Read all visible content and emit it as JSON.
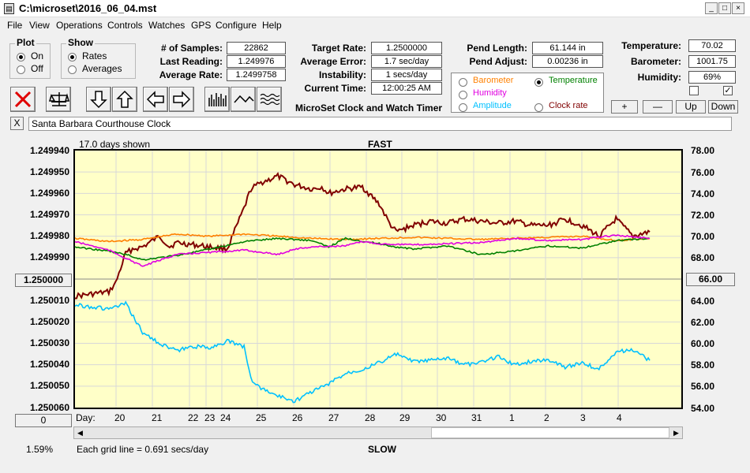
{
  "window": {
    "title": "C:\\microset\\2016_06_04.mst",
    "minimize": "_",
    "maximize": "□",
    "close": "×"
  },
  "menu": [
    "File",
    "View",
    "Operations",
    "Controls",
    "Watches",
    "GPS",
    "Configure",
    "Help"
  ],
  "plot_group": {
    "title": "Plot",
    "options": [
      {
        "label": "On",
        "selected": true
      },
      {
        "label": "Off",
        "selected": false
      }
    ]
  },
  "show_group": {
    "title": "Show",
    "options": [
      {
        "label": "Rates",
        "selected": true
      },
      {
        "label": "Averages",
        "selected": false
      }
    ]
  },
  "stats": {
    "samples_label": "# of Samples:",
    "samples": "22862",
    "last_label": "Last Reading:",
    "last": "1.249976",
    "avg_label": "Average Rate:",
    "avg": "1.2499758",
    "target_label": "Target Rate:",
    "target": "1.2500000",
    "avgerr_label": "Average Error:",
    "avgerr": "1.7 sec/day",
    "instab_label": "Instability:",
    "instab": "1 secs/day",
    "time_label": "Current Time:",
    "time": "12:00:25 AM",
    "app_name": "MicroSet Clock and Watch Timer",
    "pendlen_label": "Pend Length:",
    "pendlen": "61.144 in",
    "pendadj_label": "Pend Adjust:",
    "pendadj": "0.00236 in",
    "temp_label": "Temperature:",
    "temp": "70.02",
    "baro_label": "Barometer:",
    "baro": "1001.75",
    "hum_label": "Humidity:",
    "hum": "69%"
  },
  "sensor_select": {
    "options": [
      {
        "label": "Barometer",
        "color": "#ff8000",
        "selected": false
      },
      {
        "label": "Temperature",
        "color": "#008000",
        "selected": true
      },
      {
        "label": "Humidity",
        "color": "#e000e0",
        "selected": false
      },
      {
        "label": "Amplitude",
        "color": "#00c0ff",
        "selected": false
      },
      {
        "label": "Clock rate",
        "color": "#800000",
        "selected": false
      }
    ]
  },
  "scale_buttons": [
    "+",
    "—",
    "Up",
    "Down"
  ],
  "checkboxes": [
    {
      "checked": false
    },
    {
      "checked": true
    }
  ],
  "toolbar": [
    "close-x",
    "balance-scale",
    "arrow-down",
    "arrow-up",
    "arrow-left",
    "arrow-right",
    "bars",
    "wave",
    "multi-wave"
  ],
  "clock_name": "Santa Barbara Courthouse Clock",
  "clear_label": "X",
  "chart_data": {
    "type": "line",
    "header_left": "17.0 days shown",
    "title_top": "FAST",
    "title_bottom": "SLOW",
    "footer_left": "1.59%",
    "footer_grid": "Each grid line = 0.691 secs/day",
    "left_axis": {
      "ticks": [
        "1.249940",
        "1.249950",
        "1.249960",
        "1.249970",
        "1.249980",
        "1.249990",
        "1.250000",
        "1.250010",
        "1.250020",
        "1.250030",
        "1.250040",
        "1.250050",
        "1.250060"
      ],
      "range": [
        1.24994,
        1.25006
      ],
      "center_button": "1.250000",
      "bottom_button": "0"
    },
    "right_axis": {
      "ticks": [
        "78.00",
        "76.00",
        "74.00",
        "72.00",
        "70.00",
        "68.00",
        "66.00",
        "64.00",
        "62.00",
        "60.00",
        "58.00",
        "56.00",
        "54.00"
      ],
      "range": [
        54,
        78
      ],
      "center_button": "66.00"
    },
    "x_label": "Day:",
    "days": [
      "20",
      "21",
      "22",
      "23",
      "24",
      "25",
      "26",
      "27",
      "28",
      "29",
      "30",
      "31",
      "1",
      "2",
      "3",
      "4"
    ],
    "series": [
      {
        "name": "Clock rate",
        "color": "#800000",
        "x": [
          0,
          1,
          1.2,
          1.35,
          1.5,
          1.7,
          2,
          2.3,
          2.5,
          2.8,
          3,
          3.5,
          4,
          4.5,
          5,
          5.2,
          5.5,
          6,
          6.5,
          7,
          7.3,
          7.5,
          8,
          8.5,
          9,
          9.3,
          9.5,
          10,
          10.5,
          11,
          11.5,
          12,
          12.5,
          13,
          13.5,
          14,
          14.5,
          15,
          15.5,
          16,
          16.5,
          17
        ],
        "y": [
          1.250008,
          1.250006,
          1.250002,
          1.249995,
          1.249988,
          1.249986,
          1.249985,
          1.249982,
          1.24998,
          1.249985,
          1.249983,
          1.249984,
          1.249985,
          1.249986,
          1.249967,
          1.249958,
          1.249955,
          1.249952,
          1.249956,
          1.249958,
          1.249957,
          1.24996,
          1.249958,
          1.249957,
          1.249965,
          1.249974,
          1.249978,
          1.249975,
          1.249973,
          1.249974,
          1.249972,
          1.249973,
          1.249974,
          1.249973,
          1.249975,
          1.249975,
          1.249972,
          1.249975,
          1.24998,
          1.249972,
          1.24998,
          1.249978
        ]
      },
      {
        "name": "Barometer",
        "color": "#ff8000",
        "x": [
          0,
          1,
          2,
          3,
          4,
          5,
          6,
          7,
          8,
          9,
          10,
          11,
          12,
          13,
          14,
          15,
          16,
          17
        ],
        "y": [
          69.8,
          69.5,
          69.7,
          70.2,
          70.0,
          70.2,
          70.0,
          69.8,
          69.7,
          69.8,
          69.9,
          69.8,
          69.7,
          69.8,
          69.9,
          70.0,
          69.6,
          69.8
        ]
      },
      {
        "name": "Temperature",
        "color": "#008000",
        "x": [
          0,
          1,
          1.5,
          2,
          3,
          3.5,
          4,
          5,
          6,
          7,
          7.5,
          8,
          9,
          9.5,
          10,
          11,
          12,
          13,
          14,
          15,
          16,
          17
        ],
        "y": [
          69.0,
          68.6,
          68.3,
          67.8,
          68.2,
          68.5,
          68.8,
          69.5,
          69.8,
          69.6,
          69.0,
          69.8,
          69.3,
          69.0,
          68.8,
          69.1,
          68.3,
          68.6,
          69.1,
          68.9,
          69.6,
          69.8
        ]
      },
      {
        "name": "Humidity",
        "color": "#e000e0",
        "x": [
          0,
          1,
          2,
          3,
          4,
          5,
          6,
          6.5,
          7,
          8,
          8.5,
          9,
          10,
          11,
          12,
          13,
          14,
          15,
          16,
          17
        ],
        "y": [
          69.5,
          68.7,
          67.2,
          68.3,
          68.5,
          68.7,
          68.3,
          68.8,
          69.0,
          69.1,
          69.5,
          69.3,
          69.2,
          69.3,
          69.4,
          69.8,
          69.6,
          69.7,
          70.1,
          69.8
        ]
      },
      {
        "name": "Amplitude",
        "color": "#00c0ff",
        "x": [
          0,
          1,
          1.5,
          2,
          2.5,
          3,
          3.5,
          4,
          4.5,
          5,
          5.2,
          5.5,
          6,
          6.5,
          7,
          7.5,
          8,
          8.5,
          9,
          9.5,
          10,
          10.5,
          11,
          11.5,
          12,
          12.5,
          13,
          13.5,
          14,
          14.5,
          15,
          15.5,
          16,
          16.5,
          17
        ],
        "y": [
          63.6,
          63.2,
          63.7,
          61.0,
          60.0,
          59.3,
          59.7,
          59.6,
          60.2,
          59.7,
          56.7,
          55.8,
          55.1,
          54.6,
          55.5,
          56.2,
          57.2,
          57.6,
          58.2,
          59.0,
          58.3,
          58.4,
          58.6,
          58.0,
          58.2,
          58.8,
          58.0,
          58.3,
          58.5,
          57.8,
          58.2,
          57.6,
          59.2,
          59.4,
          58.4
        ]
      }
    ]
  }
}
